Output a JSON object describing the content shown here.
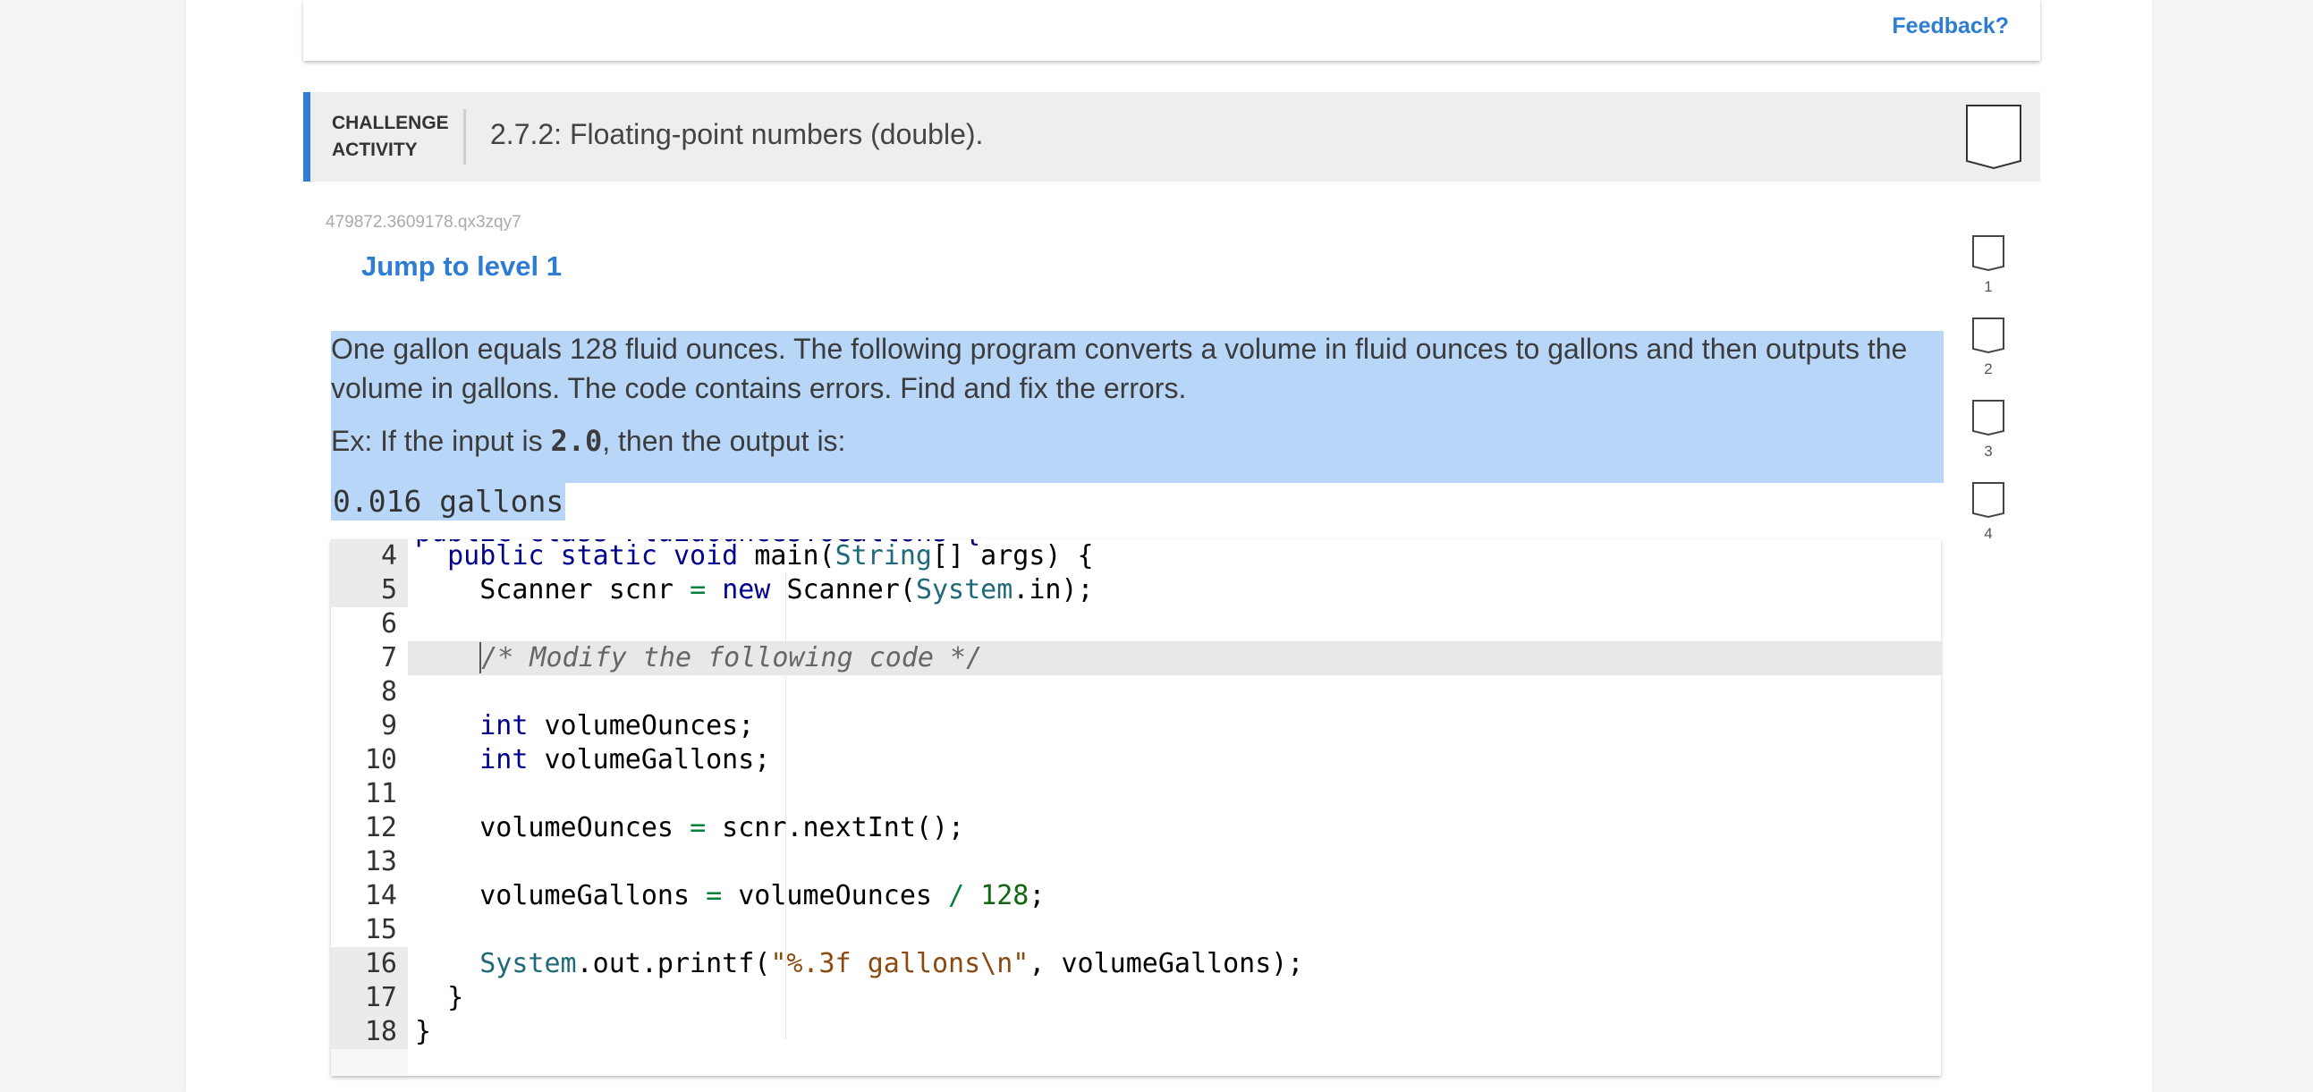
{
  "feedback": "Feedback?",
  "header": {
    "label_line1": "CHALLENGE",
    "label_line2": "ACTIVITY",
    "title": "2.7.2: Floating-point numbers (double)."
  },
  "activity_id": "479872.3609178.qx3zqy7",
  "jump_link": "Jump to level 1",
  "levels": [
    "1",
    "2",
    "3",
    "4"
  ],
  "prompt": {
    "paragraph": "One gallon equals 128 fluid ounces. The following program converts a volume in fluid ounces to gallons and then outputs the volume in gallons. The code contains errors. Find and fix the errors.",
    "example_prefix": "Ex: If the input is ",
    "example_value": "2.0",
    "example_suffix": ", then the output is:",
    "output": "0.016 gallons"
  },
  "editor": {
    "line_numbers": [
      "4",
      "5",
      "6",
      "7",
      "8",
      "9",
      "10",
      "11",
      "12",
      "13",
      "14",
      "15",
      "16",
      "17",
      "18"
    ],
    "clipped_line": "public class FluidOuncesToGallons {",
    "line4": {
      "kw1": "public",
      "kw2": "static",
      "kw3": "void",
      "a": "main(",
      "ty": "String",
      "b": "[] args) {"
    },
    "line5": {
      "a": "Scanner scnr ",
      "op": "=",
      "kw": "new",
      "b": "Scanner(",
      "ty": "System",
      "c": ".in);"
    },
    "line7": {
      "comment": "/* Modify the following code */"
    },
    "line9": {
      "kw": "int",
      "a": "volumeOunces;"
    },
    "line10": {
      "kw": "int",
      "a": "volumeGallons;"
    },
    "line12": {
      "a": "volumeOunces ",
      "op": "=",
      "b": " scnr.nextInt();"
    },
    "line14": {
      "a": "volumeGallons ",
      "op": "=",
      "b": " volumeOunces ",
      "op2": "/",
      "num": "128",
      "c": ";"
    },
    "line16": {
      "ty": "System",
      "a": ".out.printf(",
      "str": "\"%.3f gallons\\n\"",
      "b": ", volumeGallons);"
    },
    "line17": {
      "a": "}"
    },
    "line18": {
      "a": "}"
    }
  }
}
